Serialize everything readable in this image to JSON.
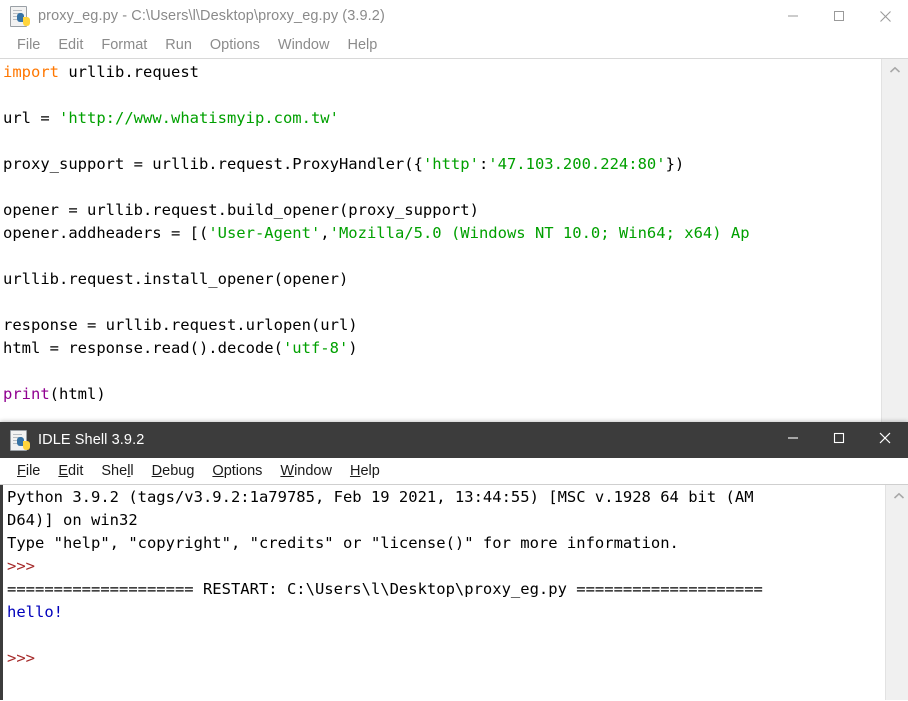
{
  "editor_window": {
    "title": "proxy_eg.py - C:\\Users\\l\\Desktop\\proxy_eg.py (3.9.2)",
    "icon": "python-file-icon",
    "controls": {
      "minimize": "minimize-icon",
      "maximize": "maximize-icon",
      "close": "close-icon"
    },
    "menu": [
      {
        "label": "File"
      },
      {
        "label": "Edit"
      },
      {
        "label": "Format"
      },
      {
        "label": "Run"
      },
      {
        "label": "Options"
      },
      {
        "label": "Window"
      },
      {
        "label": "Help"
      }
    ],
    "code_lines": [
      [
        {
          "t": "import",
          "c": "kw"
        },
        {
          "t": " urllib.request",
          "c": ""
        }
      ],
      [],
      [
        {
          "t": "url = ",
          "c": ""
        },
        {
          "t": "'http://www.whatismyip.com.tw'",
          "c": "str"
        }
      ],
      [],
      [
        {
          "t": "proxy_support = urllib.request.ProxyHandler({",
          "c": ""
        },
        {
          "t": "'http'",
          "c": "str"
        },
        {
          "t": ":",
          "c": ""
        },
        {
          "t": "'47.103.200.224:80'",
          "c": "str"
        },
        {
          "t": "})",
          "c": ""
        }
      ],
      [],
      [
        {
          "t": "opener = urllib.request.build_opener(proxy_support)",
          "c": ""
        }
      ],
      [
        {
          "t": "opener.addheaders = [(",
          "c": ""
        },
        {
          "t": "'User-Agent'",
          "c": "str"
        },
        {
          "t": ",",
          "c": ""
        },
        {
          "t": "'Mozilla/5.0 (Windows NT 10.0; Win64; x64) Ap",
          "c": "str"
        }
      ],
      [],
      [
        {
          "t": "urllib.request.install_opener(opener)",
          "c": ""
        }
      ],
      [],
      [
        {
          "t": "response = urllib.request.urlopen(url)",
          "c": ""
        }
      ],
      [
        {
          "t": "html = response.read().decode(",
          "c": ""
        },
        {
          "t": "'utf-8'",
          "c": "str"
        },
        {
          "t": ")",
          "c": ""
        }
      ],
      [],
      [
        {
          "t": "print",
          "c": "builtin"
        },
        {
          "t": "(html)",
          "c": ""
        }
      ]
    ],
    "scrollbar": {
      "up_arrow": "chevron-up-icon"
    }
  },
  "shell_window": {
    "title": "IDLE Shell 3.9.2",
    "icon": "python-file-icon",
    "controls": {
      "minimize": "minimize-icon",
      "maximize": "maximize-icon",
      "close": "close-icon"
    },
    "menu": [
      {
        "pre": "",
        "mn": "F",
        "post": "ile"
      },
      {
        "pre": "",
        "mn": "E",
        "post": "dit"
      },
      {
        "pre": "She",
        "mn": "l",
        "post": "l"
      },
      {
        "pre": "",
        "mn": "D",
        "post": "ebug"
      },
      {
        "pre": "",
        "mn": "O",
        "post": "ptions"
      },
      {
        "pre": "",
        "mn": "W",
        "post": "indow"
      },
      {
        "pre": "",
        "mn": "H",
        "post": "elp"
      }
    ],
    "output_lines": [
      [
        {
          "t": "Python 3.9.2 (tags/v3.9.2:1a79785, Feb 19 2021, 13:44:55) [MSC v.1928 64 bit (AM",
          "c": ""
        }
      ],
      [
        {
          "t": "D64)] on win32",
          "c": ""
        }
      ],
      [
        {
          "t": "Type \"help\", \"copyright\", \"credits\" or \"license()\" for more information.",
          "c": ""
        }
      ],
      [
        {
          "t": ">>>",
          "c": "prompt"
        }
      ],
      [
        {
          "t": "==================== RESTART: C:\\Users\\l\\Desktop\\proxy_eg.py ====================",
          "c": ""
        }
      ],
      [
        {
          "t": "hello!",
          "c": "stdout"
        }
      ],
      [],
      [
        {
          "t": ">>>",
          "c": "prompt"
        }
      ]
    ],
    "scrollbar": {
      "up_arrow": "chevron-up-icon"
    }
  },
  "colors": {
    "keyword": "#FF7700",
    "string": "#00A000",
    "builtin": "#900090",
    "prompt": "#A52A2A",
    "stdout": "#0000BB",
    "active_titlebar": "#3c3c3c"
  }
}
